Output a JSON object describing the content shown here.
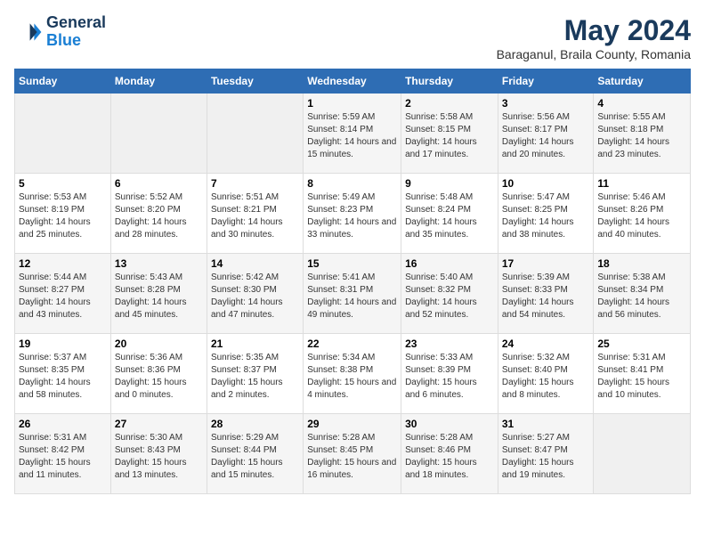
{
  "header": {
    "logo_general": "General",
    "logo_blue": "Blue",
    "main_title": "May 2024",
    "subtitle": "Baraganul, Braila County, Romania"
  },
  "days_of_week": [
    "Sunday",
    "Monday",
    "Tuesday",
    "Wednesday",
    "Thursday",
    "Friday",
    "Saturday"
  ],
  "weeks": [
    [
      {
        "day": "",
        "sunrise": "",
        "sunset": "",
        "daylight": ""
      },
      {
        "day": "",
        "sunrise": "",
        "sunset": "",
        "daylight": ""
      },
      {
        "day": "",
        "sunrise": "",
        "sunset": "",
        "daylight": ""
      },
      {
        "day": "1",
        "sunrise": "Sunrise: 5:59 AM",
        "sunset": "Sunset: 8:14 PM",
        "daylight": "Daylight: 14 hours and 15 minutes."
      },
      {
        "day": "2",
        "sunrise": "Sunrise: 5:58 AM",
        "sunset": "Sunset: 8:15 PM",
        "daylight": "Daylight: 14 hours and 17 minutes."
      },
      {
        "day": "3",
        "sunrise": "Sunrise: 5:56 AM",
        "sunset": "Sunset: 8:17 PM",
        "daylight": "Daylight: 14 hours and 20 minutes."
      },
      {
        "day": "4",
        "sunrise": "Sunrise: 5:55 AM",
        "sunset": "Sunset: 8:18 PM",
        "daylight": "Daylight: 14 hours and 23 minutes."
      }
    ],
    [
      {
        "day": "5",
        "sunrise": "Sunrise: 5:53 AM",
        "sunset": "Sunset: 8:19 PM",
        "daylight": "Daylight: 14 hours and 25 minutes."
      },
      {
        "day": "6",
        "sunrise": "Sunrise: 5:52 AM",
        "sunset": "Sunset: 8:20 PM",
        "daylight": "Daylight: 14 hours and 28 minutes."
      },
      {
        "day": "7",
        "sunrise": "Sunrise: 5:51 AM",
        "sunset": "Sunset: 8:21 PM",
        "daylight": "Daylight: 14 hours and 30 minutes."
      },
      {
        "day": "8",
        "sunrise": "Sunrise: 5:49 AM",
        "sunset": "Sunset: 8:23 PM",
        "daylight": "Daylight: 14 hours and 33 minutes."
      },
      {
        "day": "9",
        "sunrise": "Sunrise: 5:48 AM",
        "sunset": "Sunset: 8:24 PM",
        "daylight": "Daylight: 14 hours and 35 minutes."
      },
      {
        "day": "10",
        "sunrise": "Sunrise: 5:47 AM",
        "sunset": "Sunset: 8:25 PM",
        "daylight": "Daylight: 14 hours and 38 minutes."
      },
      {
        "day": "11",
        "sunrise": "Sunrise: 5:46 AM",
        "sunset": "Sunset: 8:26 PM",
        "daylight": "Daylight: 14 hours and 40 minutes."
      }
    ],
    [
      {
        "day": "12",
        "sunrise": "Sunrise: 5:44 AM",
        "sunset": "Sunset: 8:27 PM",
        "daylight": "Daylight: 14 hours and 43 minutes."
      },
      {
        "day": "13",
        "sunrise": "Sunrise: 5:43 AM",
        "sunset": "Sunset: 8:28 PM",
        "daylight": "Daylight: 14 hours and 45 minutes."
      },
      {
        "day": "14",
        "sunrise": "Sunrise: 5:42 AM",
        "sunset": "Sunset: 8:30 PM",
        "daylight": "Daylight: 14 hours and 47 minutes."
      },
      {
        "day": "15",
        "sunrise": "Sunrise: 5:41 AM",
        "sunset": "Sunset: 8:31 PM",
        "daylight": "Daylight: 14 hours and 49 minutes."
      },
      {
        "day": "16",
        "sunrise": "Sunrise: 5:40 AM",
        "sunset": "Sunset: 8:32 PM",
        "daylight": "Daylight: 14 hours and 52 minutes."
      },
      {
        "day": "17",
        "sunrise": "Sunrise: 5:39 AM",
        "sunset": "Sunset: 8:33 PM",
        "daylight": "Daylight: 14 hours and 54 minutes."
      },
      {
        "day": "18",
        "sunrise": "Sunrise: 5:38 AM",
        "sunset": "Sunset: 8:34 PM",
        "daylight": "Daylight: 14 hours and 56 minutes."
      }
    ],
    [
      {
        "day": "19",
        "sunrise": "Sunrise: 5:37 AM",
        "sunset": "Sunset: 8:35 PM",
        "daylight": "Daylight: 14 hours and 58 minutes."
      },
      {
        "day": "20",
        "sunrise": "Sunrise: 5:36 AM",
        "sunset": "Sunset: 8:36 PM",
        "daylight": "Daylight: 15 hours and 0 minutes."
      },
      {
        "day": "21",
        "sunrise": "Sunrise: 5:35 AM",
        "sunset": "Sunset: 8:37 PM",
        "daylight": "Daylight: 15 hours and 2 minutes."
      },
      {
        "day": "22",
        "sunrise": "Sunrise: 5:34 AM",
        "sunset": "Sunset: 8:38 PM",
        "daylight": "Daylight: 15 hours and 4 minutes."
      },
      {
        "day": "23",
        "sunrise": "Sunrise: 5:33 AM",
        "sunset": "Sunset: 8:39 PM",
        "daylight": "Daylight: 15 hours and 6 minutes."
      },
      {
        "day": "24",
        "sunrise": "Sunrise: 5:32 AM",
        "sunset": "Sunset: 8:40 PM",
        "daylight": "Daylight: 15 hours and 8 minutes."
      },
      {
        "day": "25",
        "sunrise": "Sunrise: 5:31 AM",
        "sunset": "Sunset: 8:41 PM",
        "daylight": "Daylight: 15 hours and 10 minutes."
      }
    ],
    [
      {
        "day": "26",
        "sunrise": "Sunrise: 5:31 AM",
        "sunset": "Sunset: 8:42 PM",
        "daylight": "Daylight: 15 hours and 11 minutes."
      },
      {
        "day": "27",
        "sunrise": "Sunrise: 5:30 AM",
        "sunset": "Sunset: 8:43 PM",
        "daylight": "Daylight: 15 hours and 13 minutes."
      },
      {
        "day": "28",
        "sunrise": "Sunrise: 5:29 AM",
        "sunset": "Sunset: 8:44 PM",
        "daylight": "Daylight: 15 hours and 15 minutes."
      },
      {
        "day": "29",
        "sunrise": "Sunrise: 5:28 AM",
        "sunset": "Sunset: 8:45 PM",
        "daylight": "Daylight: 15 hours and 16 minutes."
      },
      {
        "day": "30",
        "sunrise": "Sunrise: 5:28 AM",
        "sunset": "Sunset: 8:46 PM",
        "daylight": "Daylight: 15 hours and 18 minutes."
      },
      {
        "day": "31",
        "sunrise": "Sunrise: 5:27 AM",
        "sunset": "Sunset: 8:47 PM",
        "daylight": "Daylight: 15 hours and 19 minutes."
      },
      {
        "day": "",
        "sunrise": "",
        "sunset": "",
        "daylight": ""
      }
    ]
  ]
}
